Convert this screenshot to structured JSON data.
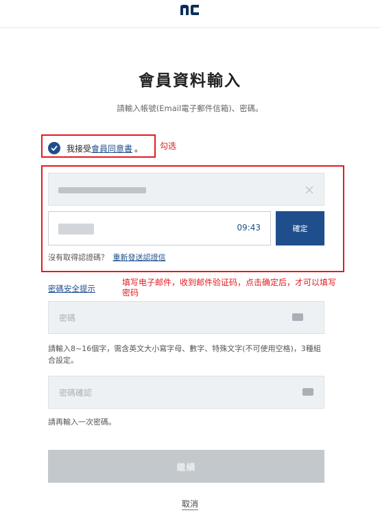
{
  "header": {
    "logo_text": "nc"
  },
  "page": {
    "title": "會員資料輸入",
    "subtitle": "請輸入帳號(Email電子郵件信箱)、密碼。"
  },
  "agreement": {
    "prefix": "我接受",
    "link": "會員同意書",
    "suffix": "。",
    "checked": true
  },
  "email": {
    "value_masked": true
  },
  "verification": {
    "timer": "09:43",
    "confirm_label": "確定",
    "no_code_text": "沒有取得認證碼？",
    "resend_link": "重新發送認證信"
  },
  "password": {
    "tip_link": "密碼安全提示",
    "placeholder": "密碼",
    "help": "請輸入8~16個字，需含英文大小寫字母、數字、特殊文字(不可使用空格)，3種組合設定。"
  },
  "password_confirm": {
    "placeholder": "密碼確認",
    "help": "請再輸入一次密碼。"
  },
  "actions": {
    "continue_label": "繼續",
    "cancel_label": "取消"
  },
  "annotations": {
    "check_note": "勾选",
    "email_note": "填写电子邮件，收到邮件验证码，点击确定后，才可以填写密码"
  },
  "colors": {
    "brand": "#1f4e8c",
    "annotation": "#e4191d",
    "disabled": "#c3c8cd"
  }
}
